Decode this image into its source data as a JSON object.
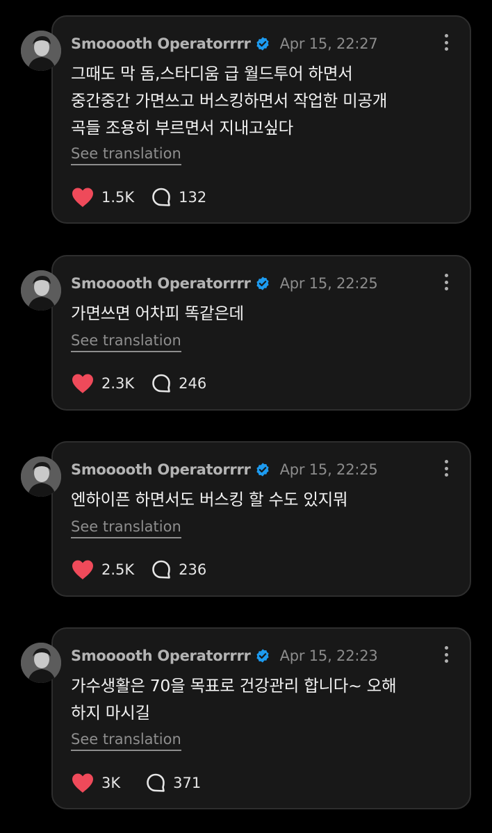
{
  "colors": {
    "background": "#000000",
    "card": "#181818",
    "heart": "#ef4a5a",
    "verified": "#1d9bf0",
    "name": "#b4b4b4",
    "meta": "#8c8c8c"
  },
  "posts": [
    {
      "author": "Smooooth Operatorrrr",
      "verified_icon": "verified-badge-icon",
      "date": "Apr 15, 22:27",
      "text": "그때도 막 돔,스타디움 급 월드투어 하면서\n중간중간 가면쓰고 버스킹하면서 작업한 미공개\n곡들 조용히 부르면서 지내고싶다",
      "translate_label": "See translation",
      "likes": "1.5K",
      "replies": "132"
    },
    {
      "author": "Smooooth Operatorrrr",
      "verified_icon": "verified-badge-icon",
      "date": "Apr 15, 22:25",
      "text": "가면쓰면 어차피 똑같은데",
      "translate_label": "See translation",
      "likes": "2.3K",
      "replies": "246"
    },
    {
      "author": "Smooooth Operatorrrr",
      "verified_icon": "verified-badge-icon",
      "date": "Apr 15, 22:25",
      "text": "엔하이픈 하면서도 버스킹 할 수도 있지뭐",
      "translate_label": "See translation",
      "likes": "2.5K",
      "replies": "236"
    },
    {
      "author": "Smooooth Operatorrrr",
      "verified_icon": "verified-badge-icon",
      "date": "Apr 15, 22:23",
      "text": "가수생활은 70을 목표로 건강관리 합니다~ 오해\n하지 마시길",
      "translate_label": "See translation",
      "likes": "3K",
      "replies": "371"
    }
  ]
}
